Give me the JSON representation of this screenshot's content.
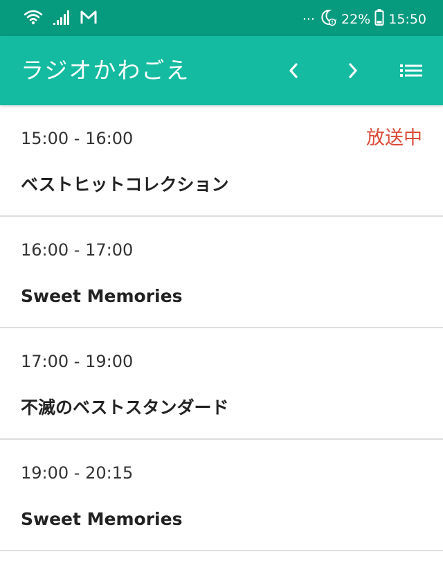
{
  "status_bar": {
    "battery": "22%",
    "time": "15:50",
    "more": "···"
  },
  "app_bar": {
    "title": "ラジオかわごえ"
  },
  "programs": [
    {
      "time": "15:00 - 16:00",
      "title": "ベストヒットコレクション",
      "badge": "放送中"
    },
    {
      "time": "16:00 - 17:00",
      "title": "Sweet Memories"
    },
    {
      "time": "17:00 - 19:00",
      "title": "不滅のベストスタンダード"
    },
    {
      "time": "19:00 - 20:15",
      "title": "Sweet Memories"
    }
  ],
  "colors": {
    "status_bar": "#069a7e",
    "app_bar": "#14bba0",
    "on_air": "#db4a38"
  },
  "icons": {
    "wifi": "wifi-icon",
    "signal": "signal-icon",
    "mail": "gmail-icon",
    "dnd": "moon-icon",
    "battery": "battery-icon",
    "prev": "chevron-left-icon",
    "next": "chevron-right-icon",
    "list": "list-icon"
  }
}
